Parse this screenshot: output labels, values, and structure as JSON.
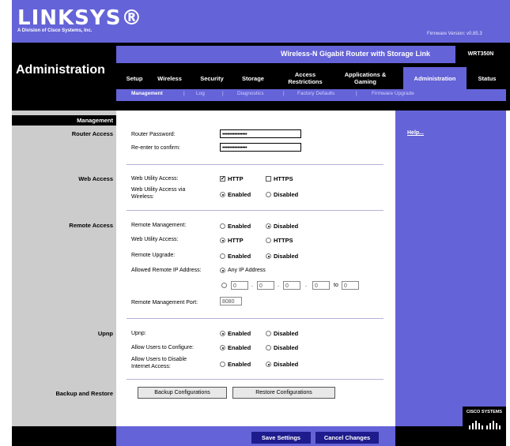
{
  "brand": {
    "logo": "LINKSYS®",
    "subtitle": "A Division of Cisco Systems, Inc.",
    "firmware": "Firmware Version: v0.85.3"
  },
  "header": {
    "page_title": "Administration",
    "product": "Wireless-N Gigabit Router with Storage Link",
    "model": "WRT350N"
  },
  "tabs": [
    "Setup",
    "Wireless",
    "Security",
    "Storage",
    "Access Restrictions",
    "Applications & Gaming",
    "Administration",
    "Status"
  ],
  "subtabs": [
    "Management",
    "Log",
    "Diagnostics",
    "Factory Defaults",
    "Firmware Upgrade"
  ],
  "sections": {
    "management": "Management",
    "router_access": "Router Access",
    "web_access": "Web Access",
    "remote_access": "Remote Access",
    "upnp": "Upnp",
    "backup": "Backup and Restore"
  },
  "help": "Help...",
  "router_access": {
    "password_label": "Router Password:",
    "password_value": "••••••••••••••••",
    "confirm_label": "Re-enter to confirm:",
    "confirm_value": "••••••••••••••••"
  },
  "web_access": {
    "utility_label": "Web Utility Access:",
    "http": "HTTP",
    "https": "HTTPS",
    "wireless_label_1": "Web Utility Access via",
    "wireless_label_2": "Wireless:",
    "enabled": "Enabled",
    "disabled": "Disabled"
  },
  "remote_access": {
    "mgmt_label": "Remote Management:",
    "utility_label": "Web Utility Access:",
    "upgrade_label": "Remote Upgrade:",
    "allowed_label": "Allowed Remote IP Address:",
    "any_ip": "Any IP Address",
    "ip_fields": [
      "0",
      "0",
      "0",
      "0"
    ],
    "to": "to",
    "to_field": "0",
    "port_label": "Remote Management Port:",
    "port_value": "8080",
    "http": "HTTP",
    "https": "HTTPS",
    "enabled": "Enabled",
    "disabled": "Disabled"
  },
  "upnp": {
    "upnp_label": "Upnp:",
    "configure_label": "Allow Users to Configure:",
    "disable_label_1": "Allow Users to Disable",
    "disable_label_2": "Internet Access:",
    "enabled": "Enabled",
    "disabled": "Disabled"
  },
  "backup": {
    "backup_btn": "Backup Configurations",
    "restore_btn": "Restore Configurations"
  },
  "footer": {
    "save": "Save Settings",
    "cancel": "Cancel Changes",
    "cisco": "CISCO SYSTEMS"
  }
}
